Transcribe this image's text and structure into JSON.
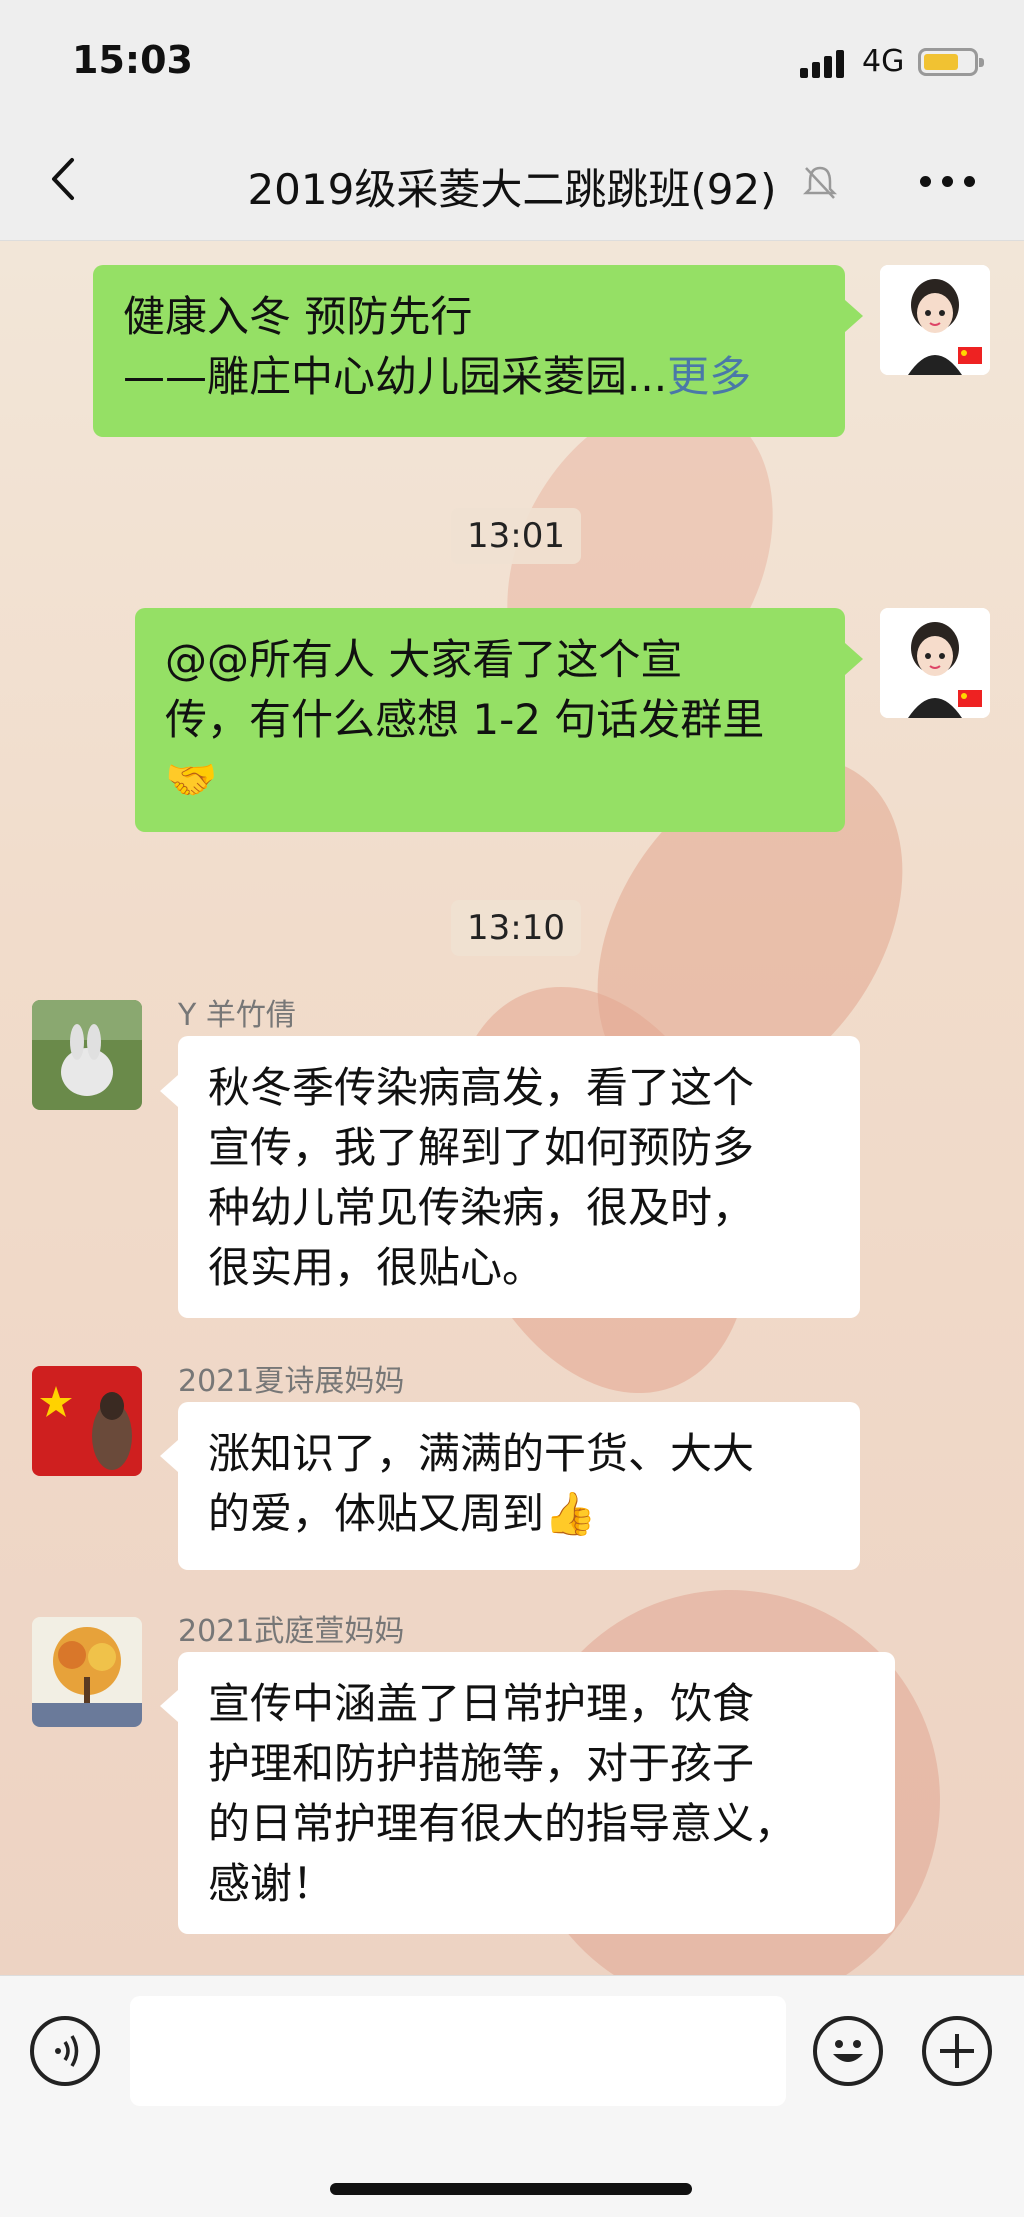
{
  "status_bar": {
    "time": "15:03",
    "network": "4G"
  },
  "nav": {
    "title": "2019级采菱大二跳跳班(92)"
  },
  "messages": [
    {
      "line1": "健康入冬  预防先行",
      "line2_prefix": "——雕庄中心幼儿园采菱园...",
      "more_link": "更多"
    },
    {
      "timestamp": "13:01"
    },
    {
      "line1": "@@所有人 大家看了这个宣",
      "line2": "传，有什么感想 1-2 句话发群里",
      "emoji": "🤝"
    },
    {
      "timestamp": "13:10"
    },
    {
      "sender": "Y 羊竹倩",
      "lines": [
        "秋冬季传染病高发，看了这个",
        "宣传，我了解到了如何预防多",
        "种幼儿常见传染病，很及时，",
        "很实用，很贴心。"
      ]
    },
    {
      "sender": "2021夏诗展妈妈",
      "lines": [
        "涨知识了，满满的干货、大大",
        "的爱，体贴又周到"
      ],
      "emoji": "👍"
    },
    {
      "sender": "2021武庭萱妈妈",
      "lines": [
        "宣传中涵盖了日常护理，饮食",
        "护理和防护措施等，对于孩子",
        "的日常护理有很大的指导意义，",
        "感谢！"
      ]
    }
  ],
  "colors": {
    "green_bubble": "#95e065",
    "white_bubble": "#ffffff",
    "bar_bg": "#eeeeee",
    "battery": "#f1c232"
  }
}
